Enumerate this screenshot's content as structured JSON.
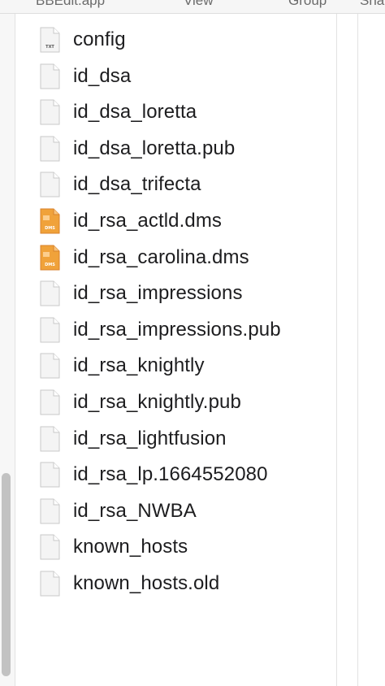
{
  "toolbar": {
    "items": [
      "BBEdit.app",
      "View",
      "Group",
      "Sha"
    ]
  },
  "files": [
    {
      "name": "config",
      "icon": "txt-file-icon",
      "badge": "TXT"
    },
    {
      "name": "id_dsa",
      "icon": "document-icon"
    },
    {
      "name": "id_dsa_loretta",
      "icon": "document-icon"
    },
    {
      "name": "id_dsa_loretta.pub",
      "icon": "document-icon"
    },
    {
      "name": "id_dsa_trifecta",
      "icon": "document-icon"
    },
    {
      "name": "id_rsa_actld.dms",
      "icon": "dms-file-icon",
      "badge": "DMS"
    },
    {
      "name": "id_rsa_carolina.dms",
      "icon": "dms-file-icon",
      "badge": "DMS"
    },
    {
      "name": "id_rsa_impressions",
      "icon": "document-icon"
    },
    {
      "name": "id_rsa_impressions.pub",
      "icon": "document-icon"
    },
    {
      "name": "id_rsa_knightly",
      "icon": "document-icon"
    },
    {
      "name": "id_rsa_knightly.pub",
      "icon": "document-icon"
    },
    {
      "name": "id_rsa_lightfusion",
      "icon": "document-icon"
    },
    {
      "name": "id_rsa_lp.1664552080",
      "icon": "document-icon"
    },
    {
      "name": "id_rsa_NWBA",
      "icon": "document-icon"
    },
    {
      "name": "known_hosts",
      "icon": "document-icon"
    },
    {
      "name": "known_hosts.old",
      "icon": "document-icon"
    }
  ],
  "colors": {
    "dms_orange": "#f0a23a",
    "dms_orange_dark": "#d9822b",
    "doc_fill": "#f4f4f4",
    "doc_stroke": "#c9c9c9",
    "text": "#1d1d1f"
  }
}
